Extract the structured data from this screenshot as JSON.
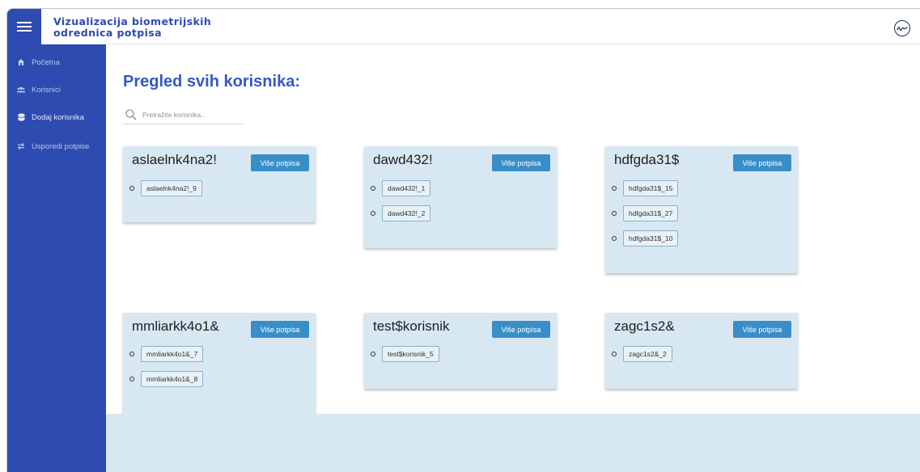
{
  "app": {
    "title": "Vizualizacija biometrijskih odrednica potpisa"
  },
  "sidebar": {
    "items": [
      {
        "label": "Početna",
        "icon": "home-icon"
      },
      {
        "label": "Korisnici",
        "icon": "users-icon"
      },
      {
        "label": "Dodaj korisnika",
        "icon": "database-icon"
      },
      {
        "label": "Usporedi potpise",
        "icon": "exchange-icon"
      }
    ]
  },
  "main": {
    "title": "Pregled svih korisnika:",
    "search": {
      "placeholder": "Pretražite korisnika..",
      "value": ""
    },
    "more_label": "Više potpisa",
    "users": [
      {
        "name": "aslaelnk4na2!",
        "signatures": [
          "aslaelnk4na2!_9"
        ]
      },
      {
        "name": "dawd432!",
        "signatures": [
          "dawd432!_1",
          "dawd432!_2"
        ]
      },
      {
        "name": "hdfgda31$",
        "signatures": [
          "hdfgda31$_15",
          "hdfgda31$_27",
          "hdfgda31$_10"
        ]
      },
      {
        "name": "mmliarkk4o1&",
        "signatures": [
          "mmliarkk4o1&_7",
          "mmliarkk4o1&_8"
        ]
      },
      {
        "name": "test$korisnik",
        "signatures": [
          "test$korisnik_5"
        ]
      },
      {
        "name": "zagc1s2&",
        "signatures": [
          "zagc1s2&_2"
        ]
      }
    ]
  },
  "colors": {
    "primary": "#2d4bb0",
    "title": "#3558c4",
    "card": "#d8e8f2",
    "button": "#3a8ec8"
  }
}
